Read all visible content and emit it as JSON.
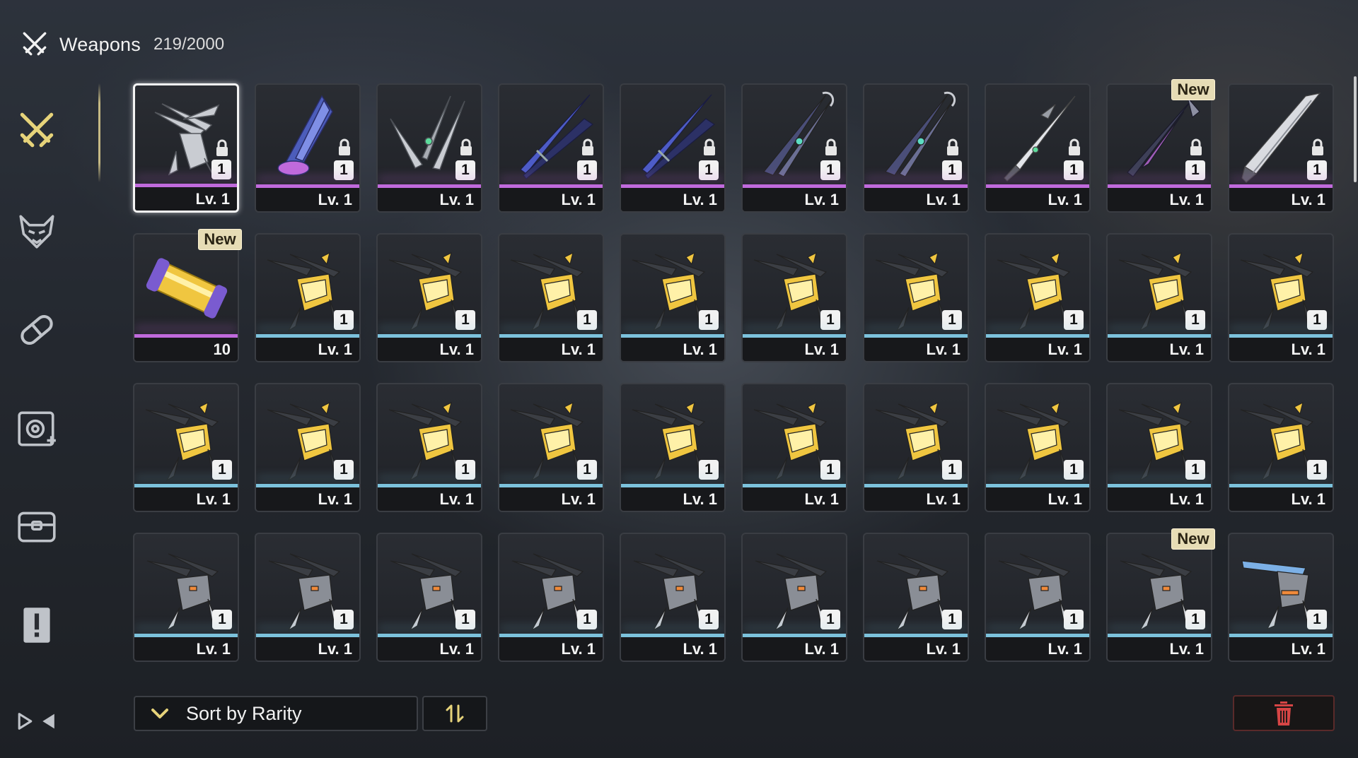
{
  "header": {
    "title": "Weapons",
    "count": "219/2000",
    "icon": "crossed-swords-icon"
  },
  "sidebar": {
    "items": [
      {
        "name": "weapons",
        "icon": "crossed-swords-icon",
        "active": true
      },
      {
        "name": "echoes",
        "icon": "demon-mask-icon",
        "active": false
      },
      {
        "name": "consumables",
        "icon": "capsule-icon",
        "active": false
      },
      {
        "name": "materials",
        "icon": "gear-plus-icon",
        "active": false
      },
      {
        "name": "resources",
        "icon": "chest-icon",
        "active": false
      },
      {
        "name": "quest-items",
        "icon": "exclamation-icon",
        "active": false
      },
      {
        "name": "special",
        "icon": "arrows-icon",
        "active": false
      }
    ]
  },
  "colors": {
    "accent_gold": "#e6d37a",
    "rarity_purple": "#c06adc",
    "rarity_blue": "#7cc2dc",
    "new_badge": "#e6dcb5",
    "delete_red": "#d64545"
  },
  "new_label": "New",
  "items": [
    {
      "art": "weapon-gauntlet",
      "rarity": "purple",
      "level": "Lv. 1",
      "stack": "1",
      "locked": true,
      "selected": true,
      "new": false
    },
    {
      "art": "weapon-pistol",
      "rarity": "purple",
      "level": "Lv. 1",
      "stack": "1",
      "locked": true,
      "new": false
    },
    {
      "art": "weapon-rectifier",
      "rarity": "purple",
      "level": "Lv. 1",
      "stack": "1",
      "locked": true,
      "new": false
    },
    {
      "art": "weapon-sword-blue",
      "rarity": "purple",
      "level": "Lv. 1",
      "stack": "1",
      "locked": true,
      "new": false
    },
    {
      "art": "weapon-sword-blue",
      "rarity": "purple",
      "level": "Lv. 1",
      "stack": "1",
      "locked": true,
      "new": false
    },
    {
      "art": "weapon-broadblade",
      "rarity": "purple",
      "level": "Lv. 1",
      "stack": "1",
      "locked": true,
      "new": false
    },
    {
      "art": "weapon-broadblade",
      "rarity": "purple",
      "level": "Lv. 1",
      "stack": "1",
      "locked": true,
      "new": false
    },
    {
      "art": "weapon-katana",
      "rarity": "purple",
      "level": "Lv. 1",
      "stack": "1",
      "locked": true,
      "new": false
    },
    {
      "art": "weapon-sword-dark",
      "rarity": "purple",
      "level": "Lv. 1",
      "stack": "1",
      "locked": true,
      "new": true
    },
    {
      "art": "weapon-greatsword",
      "rarity": "purple",
      "level": "Lv. 1",
      "stack": "1",
      "locked": true,
      "new": false
    },
    {
      "art": "material-capsule",
      "rarity": "purple",
      "level": "10",
      "stack": "",
      "locked": false,
      "new": true
    },
    {
      "art": "weapon-gold-gauntlet",
      "rarity": "blue",
      "level": "Lv. 1",
      "stack": "1",
      "locked": false,
      "new": false
    },
    {
      "art": "weapon-gold-gauntlet",
      "rarity": "blue",
      "level": "Lv. 1",
      "stack": "1",
      "locked": false,
      "new": false
    },
    {
      "art": "weapon-gold-gauntlet",
      "rarity": "blue",
      "level": "Lv. 1",
      "stack": "1",
      "locked": false,
      "new": false
    },
    {
      "art": "weapon-gold-gauntlet",
      "rarity": "blue",
      "level": "Lv. 1",
      "stack": "1",
      "locked": false,
      "new": false
    },
    {
      "art": "weapon-gold-gauntlet",
      "rarity": "blue",
      "level": "Lv. 1",
      "stack": "1",
      "locked": false,
      "new": false
    },
    {
      "art": "weapon-gold-gauntlet",
      "rarity": "blue",
      "level": "Lv. 1",
      "stack": "1",
      "locked": false,
      "new": false
    },
    {
      "art": "weapon-gold-gauntlet",
      "rarity": "blue",
      "level": "Lv. 1",
      "stack": "1",
      "locked": false,
      "new": false
    },
    {
      "art": "weapon-gold-gauntlet",
      "rarity": "blue",
      "level": "Lv. 1",
      "stack": "1",
      "locked": false,
      "new": false
    },
    {
      "art": "weapon-gold-gauntlet",
      "rarity": "blue",
      "level": "Lv. 1",
      "stack": "1",
      "locked": false,
      "new": false
    },
    {
      "art": "weapon-gold-gauntlet",
      "rarity": "blue",
      "level": "Lv. 1",
      "stack": "1",
      "locked": false,
      "new": false
    },
    {
      "art": "weapon-gold-gauntlet",
      "rarity": "blue",
      "level": "Lv. 1",
      "stack": "1",
      "locked": false,
      "new": false
    },
    {
      "art": "weapon-gold-gauntlet",
      "rarity": "blue",
      "level": "Lv. 1",
      "stack": "1",
      "locked": false,
      "new": false
    },
    {
      "art": "weapon-gold-gauntlet",
      "rarity": "blue",
      "level": "Lv. 1",
      "stack": "1",
      "locked": false,
      "new": false
    },
    {
      "art": "weapon-gold-gauntlet",
      "rarity": "blue",
      "level": "Lv. 1",
      "stack": "1",
      "locked": false,
      "new": false
    },
    {
      "art": "weapon-gold-gauntlet",
      "rarity": "blue",
      "level": "Lv. 1",
      "stack": "1",
      "locked": false,
      "new": false
    },
    {
      "art": "weapon-gold-gauntlet",
      "rarity": "blue",
      "level": "Lv. 1",
      "stack": "1",
      "locked": false,
      "new": false
    },
    {
      "art": "weapon-gold-gauntlet",
      "rarity": "blue",
      "level": "Lv. 1",
      "stack": "1",
      "locked": false,
      "new": false
    },
    {
      "art": "weapon-gold-gauntlet",
      "rarity": "blue",
      "level": "Lv. 1",
      "stack": "1",
      "locked": false,
      "new": false
    },
    {
      "art": "weapon-gold-gauntlet",
      "rarity": "blue",
      "level": "Lv. 1",
      "stack": "1",
      "locked": false,
      "new": false
    },
    {
      "art": "weapon-silver-gauntlet",
      "rarity": "blue",
      "level": "Lv. 1",
      "stack": "1",
      "locked": false,
      "new": false
    },
    {
      "art": "weapon-silver-gauntlet",
      "rarity": "blue",
      "level": "Lv. 1",
      "stack": "1",
      "locked": false,
      "new": false
    },
    {
      "art": "weapon-silver-gauntlet",
      "rarity": "blue",
      "level": "Lv. 1",
      "stack": "1",
      "locked": false,
      "new": false
    },
    {
      "art": "weapon-silver-gauntlet",
      "rarity": "blue",
      "level": "Lv. 1",
      "stack": "1",
      "locked": false,
      "new": false
    },
    {
      "art": "weapon-silver-gauntlet",
      "rarity": "blue",
      "level": "Lv. 1",
      "stack": "1",
      "locked": false,
      "new": false
    },
    {
      "art": "weapon-silver-gauntlet",
      "rarity": "blue",
      "level": "Lv. 1",
      "stack": "1",
      "locked": false,
      "new": false
    },
    {
      "art": "weapon-silver-gauntlet",
      "rarity": "blue",
      "level": "Lv. 1",
      "stack": "1",
      "locked": false,
      "new": false
    },
    {
      "art": "weapon-silver-gauntlet",
      "rarity": "blue",
      "level": "Lv. 1",
      "stack": "1",
      "locked": false,
      "new": false
    },
    {
      "art": "weapon-silver-gauntlet",
      "rarity": "blue",
      "level": "Lv. 1",
      "stack": "1",
      "locked": false,
      "new": true
    },
    {
      "art": "weapon-blue-pistol",
      "rarity": "blue",
      "level": "Lv. 1",
      "stack": "1",
      "locked": false,
      "new": false
    }
  ],
  "footer": {
    "sort_label": "Sort by Rarity",
    "sort_icon": "chevron-down-icon",
    "order_icon": "sort-order-icon",
    "delete_icon": "trash-icon"
  }
}
